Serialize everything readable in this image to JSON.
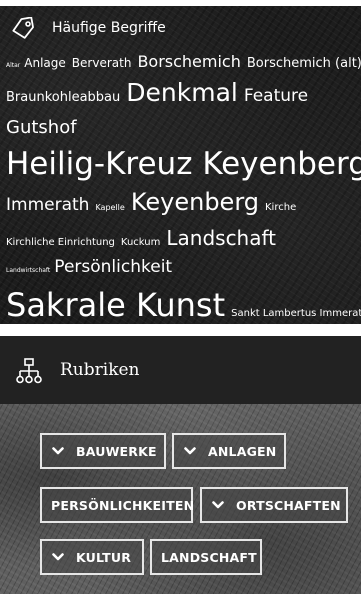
{
  "tag_widget": {
    "title": "Häufige Begriffe",
    "icon": "tag-icon",
    "tags": [
      "Altar",
      "Anlage",
      "Berverath",
      "Borschemich",
      "Borschemich (alt)",
      "Braunkohleabbau",
      "Denkmal",
      "Feature",
      "Gutshof",
      "Heilig-Kreuz Keyenberg",
      "Immerath",
      "Kapelle",
      "Keyenberg",
      "Kirche",
      "Kirchliche Einrichtung",
      "Kuckum",
      "Landschaft",
      "Landwirtschaft",
      "Persönlichkeit",
      "Sakrale Kunst",
      "Sankt Lambertus Immerath"
    ]
  },
  "categories_widget": {
    "title": "Rubriken",
    "icon": "sitemap-icon",
    "items": [
      {
        "label": "BAUWERKE",
        "expandable": true
      },
      {
        "label": "ANLAGEN",
        "expandable": true
      },
      {
        "label": "PERSÖNLICHKEITEN",
        "expandable": false
      },
      {
        "label": "ORTSCHAFTEN",
        "expandable": true
      },
      {
        "label": "KULTUR",
        "expandable": true
      },
      {
        "label": "LANDSCHAFT",
        "expandable": false
      }
    ]
  },
  "colors": {
    "text": "#ffffff",
    "tag_widget_bg": "#1d1d1d",
    "categories_header_bg": "#222222",
    "categories_body_bg": "#5f5f5f",
    "button_border": "#e6e6e6"
  }
}
